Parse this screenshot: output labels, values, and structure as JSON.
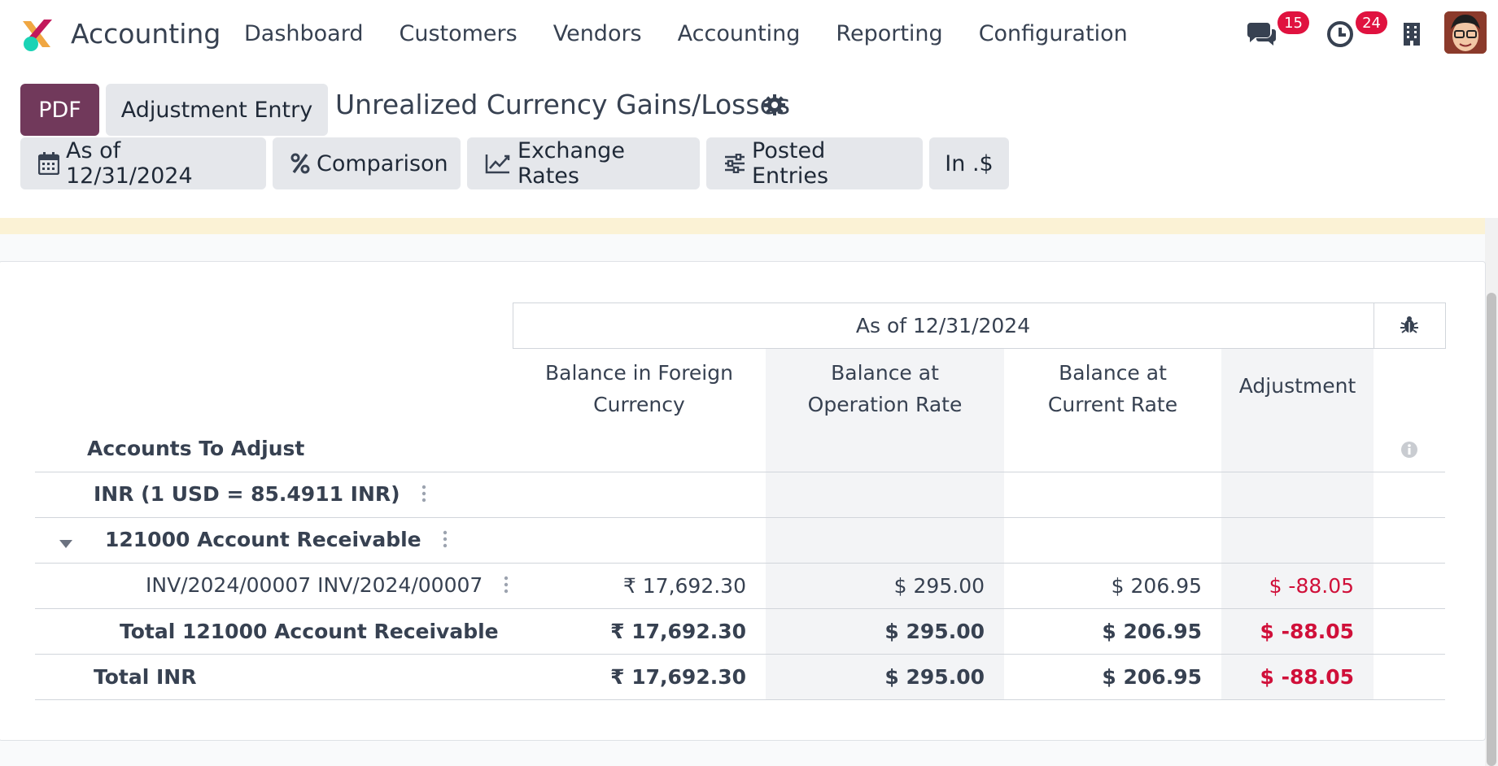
{
  "navbar": {
    "app_name": "Accounting",
    "menu": [
      "Dashboard",
      "Customers",
      "Vendors",
      "Accounting",
      "Reporting",
      "Configuration"
    ],
    "messages_count": "15",
    "activities_count": "24"
  },
  "control_panel": {
    "pdf_label": "PDF",
    "adjustment_label": "Adjustment Entry",
    "title": "Unrealized Currency Gains/Losses",
    "filters": {
      "date": "As of 12/31/2024",
      "comparison": "Comparison",
      "exchange_rates": "Exchange Rates",
      "posted": "Posted Entries",
      "currency": "In .$"
    }
  },
  "report": {
    "period_header": "As of 12/31/2024",
    "col_foreign_1": "Balance in Foreign",
    "col_foreign_2": "Currency",
    "col_operation_1": "Balance at",
    "col_operation_2": "Operation Rate",
    "col_current_1": "Balance at",
    "col_current_2": "Current Rate",
    "col_adjustment": "Adjustment",
    "accounts_title": "Accounts To Adjust",
    "rows": [
      {
        "label": "INR (1 USD = 85.4911 INR)",
        "foreign": "",
        "operation": "",
        "current": "",
        "adjustment": ""
      },
      {
        "label": "121000 Account Receivable",
        "foreign": "",
        "operation": "",
        "current": "",
        "adjustment": ""
      },
      {
        "label": "INV/2024/00007 INV/2024/00007",
        "foreign": "₹ 17,692.30",
        "operation": "$ 295.00",
        "current": "$ 206.95",
        "adjustment": "$ -88.05"
      },
      {
        "label": "Total 121000 Account Receivable",
        "foreign": "₹ 17,692.30",
        "operation": "$ 295.00",
        "current": "$ 206.95",
        "adjustment": "$ -88.05"
      },
      {
        "label": "Total INR",
        "foreign": "₹ 17,692.30",
        "operation": "$ 295.00",
        "current": "$ 206.95",
        "adjustment": "$ -88.05"
      }
    ]
  },
  "colors": {
    "primary": "#71395b",
    "negative": "#d0103a",
    "badge": "#e0123f",
    "warning_strip": "#fbf2d5"
  },
  "icons": [
    "odoo-accounting-logo",
    "chat-icon",
    "clock-icon",
    "building-icon",
    "user-avatar",
    "gear-icon",
    "calendar-icon",
    "percent-icon",
    "line-chart-icon",
    "sliders-icon",
    "bug-icon",
    "caret-down-icon",
    "kebab-icon",
    "info-icon"
  ]
}
